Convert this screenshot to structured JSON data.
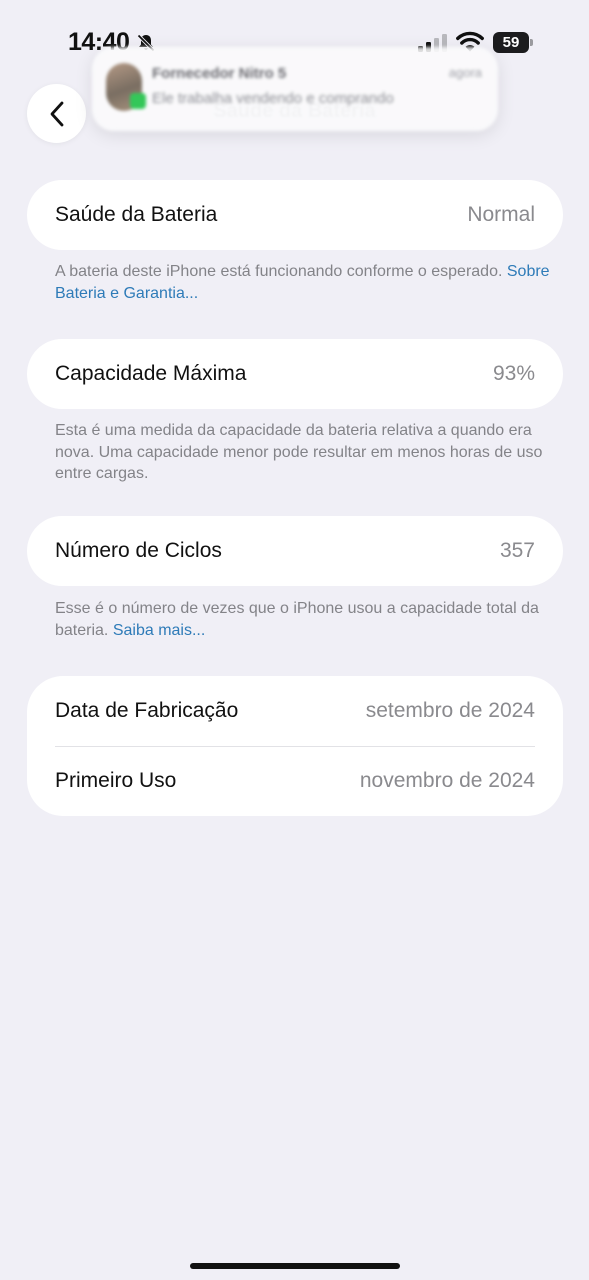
{
  "status_bar": {
    "time": "14:40",
    "battery_level": "59"
  },
  "notification": {
    "title": "Fornecedor Nitro 5",
    "body": "Ele trabalha vendendo e comprando",
    "time": "agora"
  },
  "nav": {
    "title": "Saúde da Bateria"
  },
  "battery_health": {
    "label": "Saúde da Bateria",
    "value": "Normal",
    "footnote": "A bateria deste iPhone está funcionando conforme o esperado.",
    "footnote_link": "Sobre Bateria e Garantia..."
  },
  "max_capacity": {
    "label": "Capacidade Máxima",
    "value": "93%",
    "footnote": "Esta é uma medida da capacidade da bateria relativa a quando era nova. Uma capacidade menor pode resultar em menos horas de uso entre cargas."
  },
  "cycle_count": {
    "label": "Número de Ciclos",
    "value": "357",
    "footnote": "Esse é o número de vezes que o iPhone usou a capacidade total da bateria.",
    "footnote_link": "Saiba mais..."
  },
  "dates": {
    "manufacture_label": "Data de Fabricação",
    "manufacture_value": "setembro de 2024",
    "first_use_label": "Primeiro Uso",
    "first_use_value": "novembro de 2024"
  },
  "colors": {
    "background": "#f0eff6",
    "card": "#ffffff",
    "link": "#2e7bb8",
    "secondary_text": "#8a8a8e"
  },
  "icons": {
    "back": "chevron-left-icon",
    "silent": "bell-slash-icon",
    "signal": "cellular-signal-icon",
    "wifi": "wifi-icon",
    "battery": "battery-icon"
  }
}
